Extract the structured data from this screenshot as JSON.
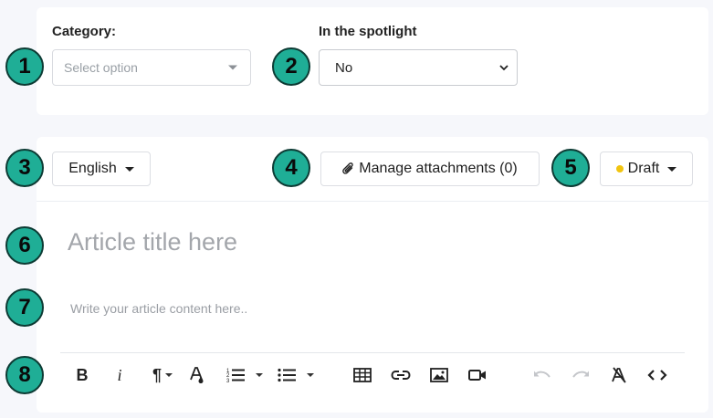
{
  "markers": [
    "1",
    "2",
    "3",
    "4",
    "5",
    "6",
    "7",
    "8"
  ],
  "category": {
    "label": "Category:",
    "placeholder": "Select option"
  },
  "spotlight": {
    "label": "In the spotlight",
    "value": "No"
  },
  "language": {
    "value": "English"
  },
  "attachments": {
    "label": "Manage attachments (0)"
  },
  "status": {
    "value": "Draft",
    "dot_color": "#f1c40f"
  },
  "editor": {
    "title_placeholder": "Article title here",
    "content_placeholder": "Write your article content here.."
  },
  "toolbar": {
    "bold": "B",
    "italic": "i",
    "paragraph": "¶",
    "items": [
      "bold-icon",
      "italic-icon",
      "paragraph-format-icon",
      "text-color-icon",
      "ordered-list-icon",
      "unordered-list-icon",
      "table-icon",
      "link-icon",
      "image-icon",
      "video-icon",
      "undo-icon",
      "redo-icon",
      "clear-formatting-icon",
      "code-view-icon"
    ]
  },
  "colors": {
    "marker": "#1fae96",
    "background": "#f6f7fb",
    "card": "#ffffff"
  }
}
